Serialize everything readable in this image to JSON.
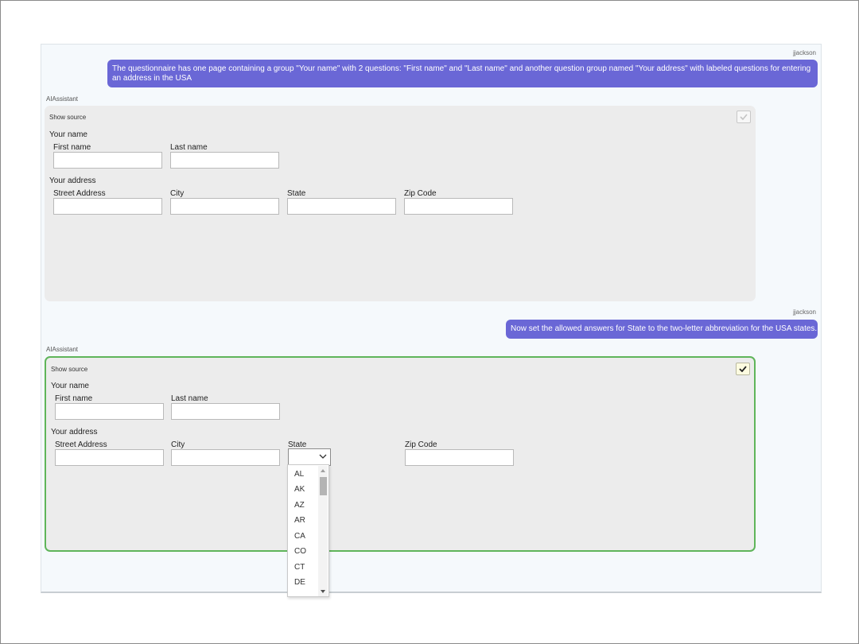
{
  "messages": {
    "first_user": {
      "username": "jjackson",
      "text": "The questionnaire has one page containing a group \"Your name\" with 2 questions: \"First name\" and \"Last name\" and another question group named \"Your address\" with labeled questions for entering an address in the USA"
    },
    "first_assistant": {
      "label": "AIAssistant",
      "show_source": "Show source",
      "group1_title": "Your name",
      "first_name": "First name",
      "last_name": "Last name",
      "group2_title": "Your address",
      "street": "Street Address",
      "city": "City",
      "state": "State",
      "zip": "Zip Code"
    },
    "second_user": {
      "username": "jjackson",
      "text": "Now set the allowed answers for State to the two-letter abbreviation for the USA states."
    },
    "second_assistant": {
      "label": "AIAssistant",
      "show_source": "Show source",
      "group1_title": "Your name",
      "first_name": "First name",
      "last_name": "Last name",
      "group2_title": "Your address",
      "street": "Street Address",
      "city": "City",
      "state": "State",
      "zip": "Zip Code",
      "state_options": [
        "AL",
        "AK",
        "AZ",
        "AR",
        "CA",
        "CO",
        "CT",
        "DE"
      ]
    }
  },
  "icons": {
    "check": "check-icon",
    "chevron": "chevron-down-icon"
  },
  "colors": {
    "user_bubble": "#6a67d6",
    "selected_border": "#5fb55a",
    "card_bg": "#ececec",
    "chat_bg": "#f5f9fc"
  }
}
